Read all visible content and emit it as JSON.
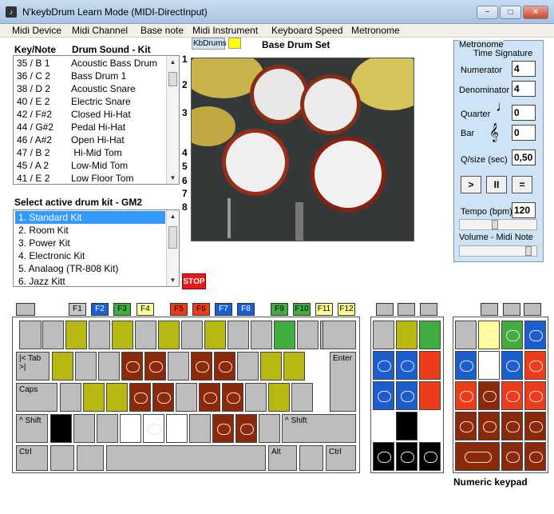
{
  "window": {
    "title": "N'keybDrum Learn Mode (MIDI-DirectInput)",
    "minimize": "−",
    "maximize": "□",
    "close": "✕"
  },
  "menu": [
    "Midi Device",
    "Midi Channel",
    "Base note",
    "Midi Instrument",
    "Keyboard Speed",
    "Metronome"
  ],
  "sounds": {
    "header_key": "Key/Note",
    "header_sound": "Drum Sound - Kit",
    "rows": [
      {
        "key": "35 / B 1",
        "name": "Acoustic Bass Drum"
      },
      {
        "key": "36 / C 2",
        "name": "Bass Drum 1"
      },
      {
        "key": "38 / D 2",
        "name": "Acoustic Snare"
      },
      {
        "key": "40 / E 2",
        "name": "Electric Snare"
      },
      {
        "key": "42 / F#2",
        "name": "Closed Hi-Hat"
      },
      {
        "key": "44 / G#2",
        "name": "Pedal Hi-Hat"
      },
      {
        "key": "46 / A#2",
        "name": "Open Hi-Hat"
      },
      {
        "key": "47 / B 2",
        "name": " Hi-Mid Tom"
      },
      {
        "key": "45 / A 2",
        "name": "Low-Mid Tom"
      },
      {
        "key": "41 / E 2",
        "name": "Low Floor Tom"
      }
    ]
  },
  "kits": {
    "header": "Select active drum kit - GM2",
    "items": [
      "1. Standard Kit",
      "2. Room Kit",
      "3. Power Kit",
      "4. Electronic Kit",
      "5. Analaog (TR-808 Kit)",
      "6. Jazz Kitt"
    ],
    "selected": 0
  },
  "side_numbers": [
    "1",
    "2",
    "3",
    "4",
    "5",
    "6",
    "7",
    "8"
  ],
  "kbdrums_label": "KbDrums",
  "set_title": "Base Drum Set",
  "stop_label": "STOP",
  "metronome": {
    "title": "Metronome",
    "time_signature": "Time Signature",
    "numerator_label": "Numerator",
    "numerator": "4",
    "denominator_label": "Denominator",
    "denominator": "4",
    "quarter_label": "Quarter",
    "quarter": "0",
    "bar_label": "Bar",
    "bar": "0",
    "qsize_label": "Q/size (sec)",
    "qsize": "0,50",
    "play": ">",
    "pause": "II",
    "equal": "=",
    "tempo_label": "Tempo (bpm)",
    "tempo": "120",
    "volume_label": "Volume - Midi Note",
    "tempo_level": 0.45,
    "volume_level": 0.93
  },
  "fkeys": [
    "F1",
    "F2",
    "F3",
    "F4",
    "F5",
    "F6",
    "F7",
    "F8",
    "F9",
    "F10",
    "F11",
    "F12"
  ],
  "fkey_colors": [
    "#c8c8c8",
    "#1a5fd0",
    "#3fae3f",
    "#ffff99",
    "#ee3b1a",
    "#ee3b1a",
    "#1a5fd0",
    "#1a5fd0",
    "#3fae3f",
    "#3fae3f",
    "#ffff99",
    "#ffff99"
  ],
  "keys": {
    "tab": "|< Tab\n>|",
    "caps": "Caps",
    "shift_l": "^ Shift",
    "shift_r": "^ Shift",
    "enter": "Enter",
    "ctrl_l": "Ctrl",
    "alt": "Alt",
    "ctrl_r": "Ctrl"
  },
  "numpad_label": "Numeric keypad",
  "colors": {
    "olive": "#b8b813",
    "brown": "#8b2a0a",
    "blue": "#1a5fd0",
    "green": "#3fae3f",
    "orange": "#ee3b1a",
    "black": "#000000",
    "gray": "#bdbdbd"
  }
}
